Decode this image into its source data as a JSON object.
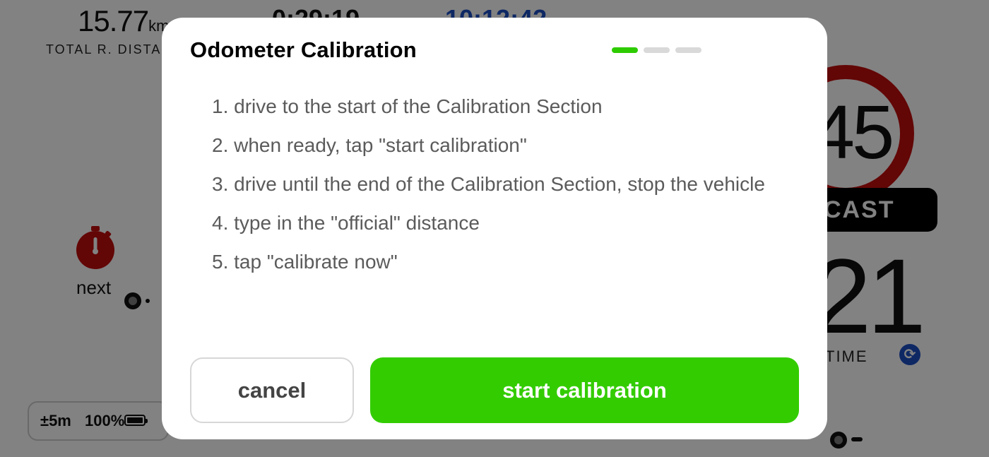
{
  "background": {
    "total_distance": {
      "value": "15.77",
      "unit": "km",
      "label": "TOTAL R. DISTA"
    },
    "time_a": "0:29:19",
    "time_b": "10:12:42",
    "next_label": "next",
    "status": {
      "accuracy": "±5m",
      "battery": "100%"
    },
    "speed_limit": "45",
    "cast_label": "CAST",
    "big_value": "21",
    "time_label": "TIME",
    "colors": {
      "sign_red": "#c30d0d",
      "accent_blue": "#1d4fc4"
    }
  },
  "modal": {
    "title": "Odometer Calibration",
    "step_indicator": {
      "total": 3,
      "active": 1,
      "active_color": "#2ecb00"
    },
    "steps": [
      "1. drive to the start of the Calibration Section",
      "2. when ready, tap \"start calibration\"",
      "3. drive until the end of the Calibration Section, stop the vehicle",
      "4. type in the \"official\" distance",
      "5. tap \"calibrate now\""
    ],
    "buttons": {
      "cancel_label": "cancel",
      "start_label": "start calibration",
      "start_color": "#33cc00"
    }
  }
}
